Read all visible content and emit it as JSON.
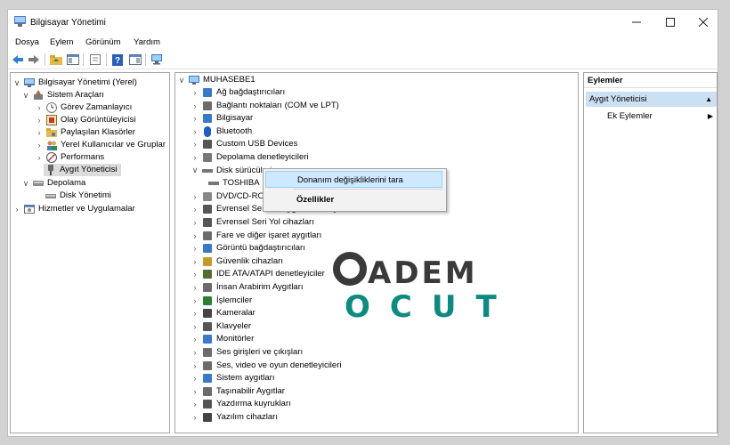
{
  "window": {
    "title": "Bilgisayar Yönetimi"
  },
  "menu": [
    "Dosya",
    "Eylem",
    "Görünüm",
    "Yardım"
  ],
  "left_tree": {
    "root": "Bilgisayar Yönetimi (Yerel)",
    "system_tools": "Sistem Araçları",
    "task_scheduler": "Görev Zamanlayıcı",
    "event_viewer": "Olay Görüntüleyicisi",
    "shared_folders": "Paylaşılan Klasörler",
    "local_users": "Yerel Kullanıcılar ve Gruplar",
    "performance": "Performans",
    "device_manager": "Aygıt Yöneticisi",
    "storage": "Depolama",
    "disk_management": "Disk Yönetimi",
    "services": "Hizmetler ve Uygulamalar"
  },
  "device_tree": {
    "computer": "MUHASEBE1",
    "categories": [
      "Ağ bağdaştırıcıları",
      "Bağlantı noktaları (COM ve LPT)",
      "Bilgisayar",
      "Bluetooth",
      "Custom USB Devices",
      "Depolama denetleyicileri",
      "Disk sürücüleri",
      "TOSHIBA",
      "DVD/CD-ROM sürücüleri",
      "Evrensel Seri Yol aygıtı denetleyicileri",
      "Evrensel Seri Yol cihazları",
      "Fare ve diğer işaret aygıtları",
      "Görüntü bağdaştırıcıları",
      "Güvenlik cihazları",
      "IDE ATA/ATAPI denetleyiciler",
      "İnsan Arabirim Aygıtları",
      "İşlemciler",
      "Kameralar",
      "Klavyeler",
      "Monitörler",
      "Ses girişleri ve çıkışları",
      "Ses, video ve oyun denetleyicileri",
      "Sistem aygıtları",
      "Taşınabilir Aygıtlar",
      "Yazdırma kuyrukları",
      "Yazılım cihazları"
    ]
  },
  "context_menu": {
    "scan": "Donanım değişikliklerini tara",
    "properties": "Özellikler"
  },
  "actions": {
    "header": "Eylemler",
    "section": "Aygıt Yöneticisi",
    "more": "Ek Eylemler"
  },
  "watermark": {
    "line1": "ADEM",
    "line2": "OCUT"
  },
  "colors": {
    "selection": "#cde8ff",
    "actions_header": "#cce0f4",
    "watermark_dark": "#3a3a3a",
    "watermark_teal": "#0f8a80"
  }
}
